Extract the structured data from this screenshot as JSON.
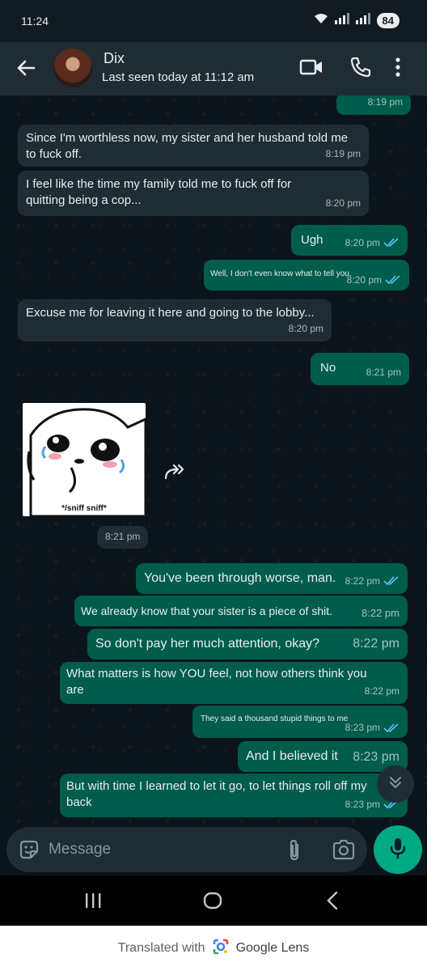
{
  "status_bar": {
    "time": "11:24",
    "battery": "84"
  },
  "header": {
    "name": "Dix",
    "last_seen": "Last seen today at 11:12 am"
  },
  "messages": [
    {
      "dir": "out",
      "text": "",
      "time": "8:19 pm",
      "ticks": false
    },
    {
      "dir": "in",
      "text": "Since I'm worthless now, my sister and her husband told me to fuck off.",
      "time": "8:19 pm"
    },
    {
      "dir": "in",
      "text": "I feel like the time my family told me to fuck off for quitting being a cop...",
      "time": "8:20 pm"
    },
    {
      "dir": "out",
      "text": "Ugh",
      "time": "8:20 pm",
      "ticks": true
    },
    {
      "dir": "out",
      "text": "Well, I don't even know what to tell you.",
      "time": "8:20 pm",
      "ticks": true
    },
    {
      "dir": "in",
      "text": "Excuse me for leaving it here and going to the lobby...",
      "time": "8:20 pm"
    },
    {
      "dir": "out",
      "text": "No",
      "time": "8:21 pm",
      "ticks": false
    },
    {
      "dir": "out",
      "text": "You've been through worse, man.",
      "time": "8:22 pm",
      "ticks": true
    },
    {
      "dir": "out",
      "text": "We already know that your sister is a piece of shit.",
      "time": "8:22 pm",
      "ticks": false
    },
    {
      "dir": "out",
      "text": "So don't pay her much attention, okay?",
      "time": "8:22 pm",
      "ticks": false
    },
    {
      "dir": "out",
      "text": "What matters is how YOU feel, not how others think you are",
      "time": "8:22 pm",
      "ticks": false
    },
    {
      "dir": "out",
      "text": "They said a thousand stupid things to me",
      "time": "8:23 pm",
      "ticks": true
    },
    {
      "dir": "out",
      "text": "And I believed it",
      "time": "8:23 pm",
      "ticks": false
    },
    {
      "dir": "out",
      "text": "But with time I learned to let it go, to let things roll off my back",
      "time": "8:23 pm",
      "ticks": true
    }
  ],
  "sticker": {
    "caption": "*/sniff sniff*",
    "time": "8:21 pm"
  },
  "input": {
    "placeholder": "Message"
  },
  "lens": {
    "prefix": "Translated with",
    "brand": "Google Lens"
  },
  "colors": {
    "incoming_bubble": "#202c33",
    "outgoing_bubble": "#005c4b",
    "read_ticks": "#53bdeb",
    "accent": "#00a884"
  }
}
